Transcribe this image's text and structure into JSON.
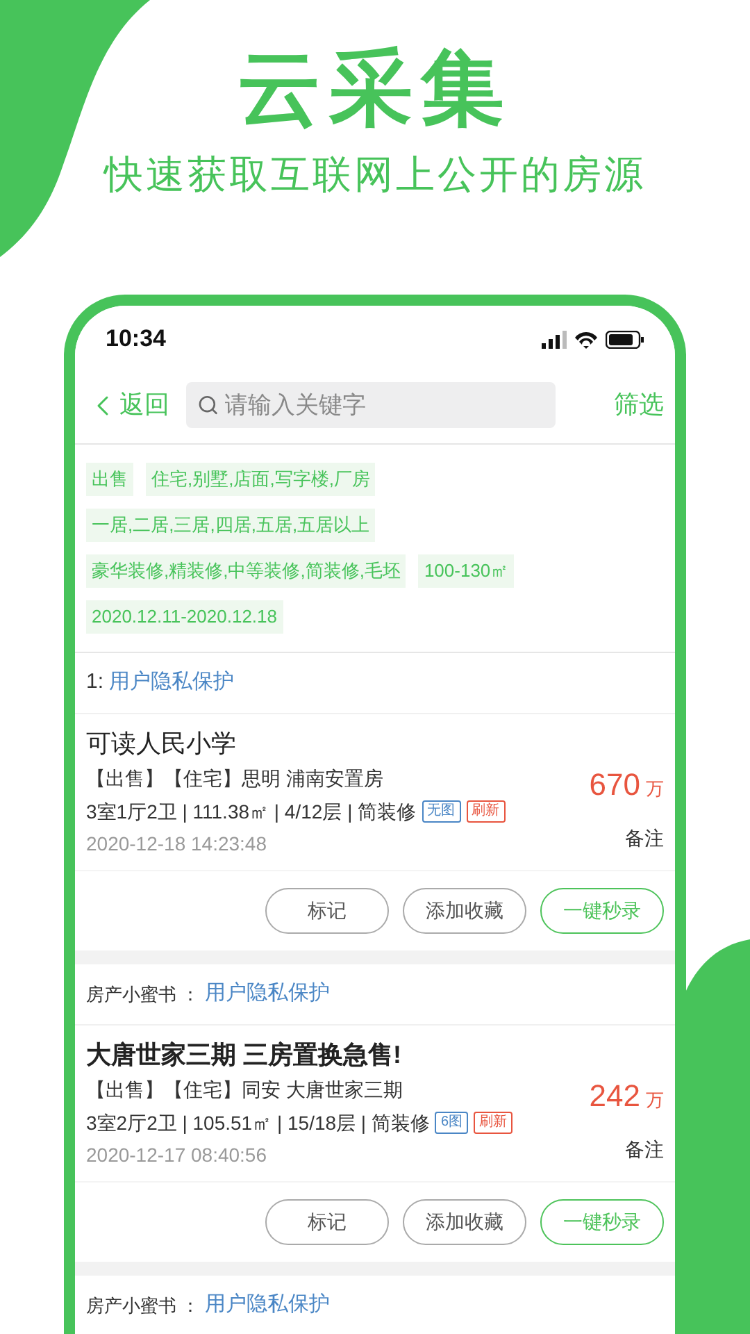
{
  "headline": {
    "title": "云采集",
    "subtitle": "快速获取互联网上公开的房源"
  },
  "status_bar": {
    "time": "10:34"
  },
  "nav": {
    "back": "返回",
    "search_placeholder": "请输入关键字",
    "filter": "筛选"
  },
  "filter_chips": [
    [
      "出售",
      "住宅,别墅,店面,写字楼,厂房"
    ],
    [
      "一居,二居,三居,四居,五居,五居以上"
    ],
    [
      "豪华装修,精装修,中等装修,简装修,毛坯",
      "100-130㎡"
    ],
    [
      "2020.12.11-2020.12.18"
    ]
  ],
  "listings": [
    {
      "source_label": "1:",
      "source": "用户隐私保护",
      "title": "可读人民小学",
      "meta": "【出售】【住宅】思明 浦南安置房",
      "specs": "3室1厅2卫 | 111.38㎡ | 4/12层 | 简装修",
      "tags": [
        {
          "text": "无图",
          "color": "#4a86c5"
        },
        {
          "text": "刷新",
          "color": "#e8553f"
        }
      ],
      "time": "2020-12-18 14:23:48",
      "price": "670",
      "unit": "万",
      "note": "备注",
      "buttons": [
        {
          "text": "标记",
          "kind": "plain"
        },
        {
          "text": "添加收藏",
          "kind": "plain"
        },
        {
          "text": "一键秒录",
          "kind": "primary"
        }
      ]
    },
    {
      "source_label": "房产小蜜书 ：",
      "source": "用户隐私保护",
      "title": "大唐世家三期 三房置换急售!",
      "meta": "【出售】【住宅】同安 大唐世家三期",
      "specs": "3室2厅2卫 | 105.51㎡ | 15/18层 | 简装修",
      "tags": [
        {
          "text": "6图",
          "color": "#4a86c5"
        },
        {
          "text": "刷新",
          "color": "#e8553f"
        }
      ],
      "time": "2020-12-17 08:40:56",
      "price": "242",
      "unit": "万",
      "note": "备注",
      "buttons": [
        {
          "text": "标记",
          "kind": "plain"
        },
        {
          "text": "添加收藏",
          "kind": "plain"
        },
        {
          "text": "一键秒录",
          "kind": "primary"
        }
      ]
    },
    {
      "source_label": "房产小蜜书 ：",
      "source": "用户隐私保护"
    }
  ]
}
